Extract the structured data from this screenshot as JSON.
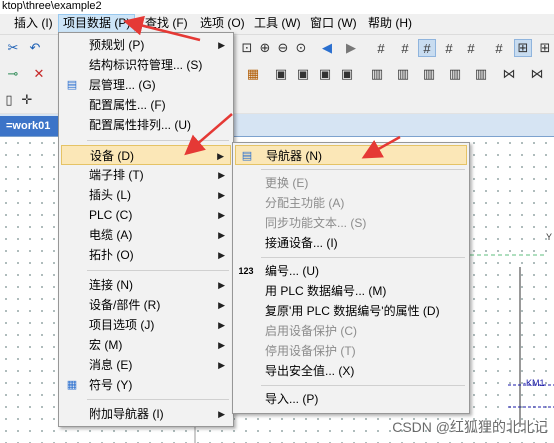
{
  "titlebar": {
    "path": "ktop\\three\\example2"
  },
  "menubar": {
    "items": [
      {
        "label": "插入 (I)"
      },
      {
        "label": "项目数据 (P)"
      },
      {
        "label": "查找 (F)"
      },
      {
        "label": "选项 (O)"
      },
      {
        "label": "工具 (W)"
      },
      {
        "label": "窗口 (W)"
      },
      {
        "label": "帮助 (H)"
      }
    ]
  },
  "tabs": {
    "active": "=work01"
  },
  "menu_project": {
    "items": [
      {
        "label": "预规划 (P)"
      },
      {
        "label": "结构标识符管理... (S)"
      },
      {
        "label": "层管理... (G)"
      },
      {
        "label": "配置属性... (F)"
      },
      {
        "label": "配置属性排列... (U)"
      },
      {
        "label": "设备 (D)"
      },
      {
        "label": "端子排 (T)"
      },
      {
        "label": "插头 (L)"
      },
      {
        "label": "PLC (C)"
      },
      {
        "label": "电缆 (A)"
      },
      {
        "label": "拓扑 (O)"
      },
      {
        "label": "连接 (N)"
      },
      {
        "label": "设备/部件 (R)"
      },
      {
        "label": "项目选项 (J)"
      },
      {
        "label": "宏 (M)"
      },
      {
        "label": "消息 (E)"
      },
      {
        "label": "符号 (Y)"
      },
      {
        "label": "附加导航器 (I)"
      }
    ]
  },
  "menu_device": {
    "items": [
      {
        "label": "导航器 (N)"
      },
      {
        "label": "更换 (E)"
      },
      {
        "label": "分配主功能 (A)"
      },
      {
        "label": "同步功能文本... (S)"
      },
      {
        "label": "接通设备... (I)"
      },
      {
        "label": "编号... (U)"
      },
      {
        "label": "用 PLC 数据编号... (M)"
      },
      {
        "label": "复原'用 PLC 数据编号'的属性 (D)"
      },
      {
        "label": "启用设备保护 (C)"
      },
      {
        "label": "停用设备保护 (T)"
      },
      {
        "label": "导出安全值... (X)"
      },
      {
        "label": "导入... (P)"
      }
    ]
  },
  "canvas": {
    "label_km": "-KM1",
    "label_y": "Y"
  },
  "watermark": "CSDN @红狐狸的北北记",
  "colors": {
    "accent": "#3c74c8",
    "highlight": "#fbe7b7",
    "annotation": "#e53935"
  }
}
